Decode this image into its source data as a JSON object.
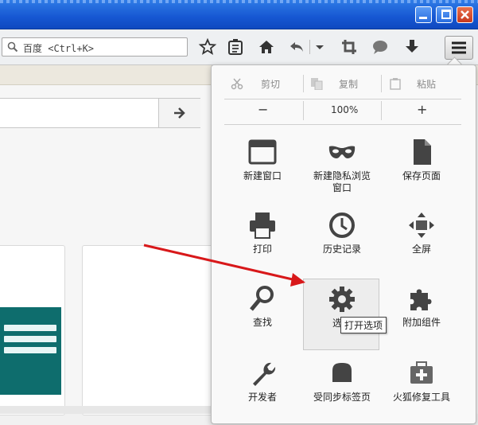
{
  "toolbar": {
    "search_placeholder": "百度 <Ctrl+K>"
  },
  "menu": {
    "edit": {
      "cut": "剪切",
      "copy": "复制",
      "paste": "粘贴"
    },
    "zoom": {
      "minus": "−",
      "level": "100%",
      "plus": "+"
    },
    "items": [
      {
        "label": "新建窗口",
        "icon": "window-icon"
      },
      {
        "label": "新建隐私浏览窗口",
        "icon": "private-mask-icon"
      },
      {
        "label": "保存页面",
        "icon": "page-icon"
      },
      {
        "label": "打印",
        "icon": "printer-icon"
      },
      {
        "label": "历史记录",
        "icon": "clock-icon"
      },
      {
        "label": "全屏",
        "icon": "fullscreen-icon"
      },
      {
        "label": "查找",
        "icon": "magnifier-icon"
      },
      {
        "label": "选项",
        "icon": "gear-icon"
      },
      {
        "label": "附加组件",
        "icon": "puzzle-icon"
      },
      {
        "label": "开发者",
        "icon": "wrench-icon"
      },
      {
        "label": "受同步标签页",
        "icon": "sync-tabs-icon"
      },
      {
        "label": "火狐修复工具",
        "icon": "repair-kit-icon"
      }
    ]
  },
  "tooltip": "打开选项",
  "colors": {
    "annotation_arrow": "#d8181a",
    "titlebar": "#1657d2"
  }
}
